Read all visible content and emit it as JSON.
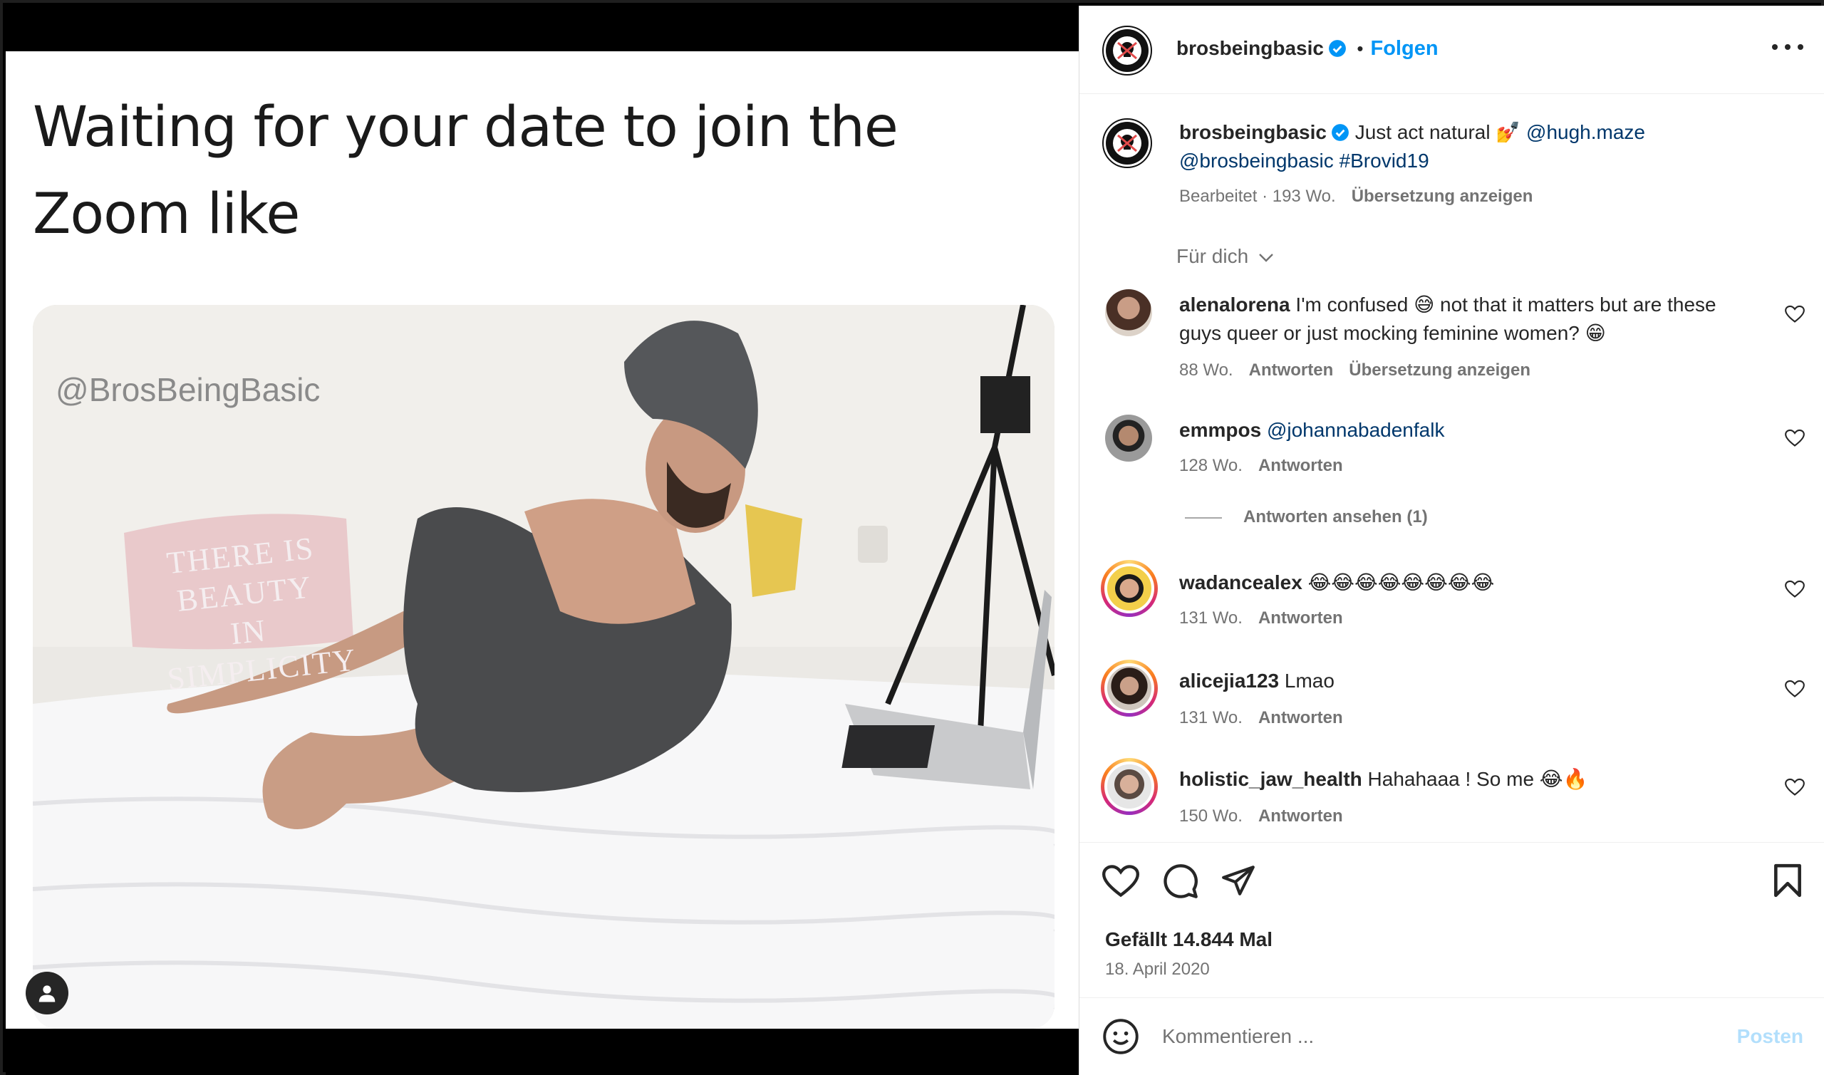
{
  "media": {
    "meme_caption": "Waiting for your date to join the Zoom like",
    "watermark": "@BrosBeingBasic",
    "pillow_text": "THERE IS BEAUTY IN SIMPLICITY"
  },
  "post": {
    "author": "brosbeingbasic",
    "follow_label": "Folgen",
    "separator": "•",
    "caption": {
      "username": "brosbeingbasic",
      "text": "Just act natural 💅",
      "mention_1": "@hugh.maze",
      "mention_2": "@brosbeingbasic",
      "hashtag": "#Brovid19",
      "meta_edited": "Bearbeitet · 193 Wo.",
      "translate": "Übersetzung anzeigen"
    },
    "sort_label": "Für dich"
  },
  "comments": [
    {
      "username": "alenalorena",
      "text": "I'm confused 😅 not that it matters but are these guys queer or just mocking feminine women? 😁",
      "time": "88 Wo.",
      "reply": "Antworten",
      "translate": "Übersetzung anzeigen"
    },
    {
      "username": "emmpos",
      "text": "",
      "mention": "@johannabadenfalk",
      "time": "128 Wo.",
      "reply": "Antworten",
      "view_replies": "Antworten ansehen (1)"
    },
    {
      "username": "wadancealex",
      "text": "😂😂😂😂😂😂😂😂",
      "time": "131 Wo.",
      "reply": "Antworten"
    },
    {
      "username": "alicejia123",
      "text": "Lmao",
      "time": "131 Wo.",
      "reply": "Antworten"
    },
    {
      "username": "holistic_jaw_health",
      "text": "Hahahaaa ! So me 😂🔥",
      "time": "150 Wo.",
      "reply": "Antworten"
    }
  ],
  "actions": {
    "likes": "Gefällt 14.844 Mal",
    "date": "18. April 2020"
  },
  "add_comment": {
    "placeholder": "Kommentieren ...",
    "post_label": "Posten"
  },
  "colors": {
    "accent": "#0095f6",
    "link": "#00376b",
    "muted": "#737373"
  }
}
